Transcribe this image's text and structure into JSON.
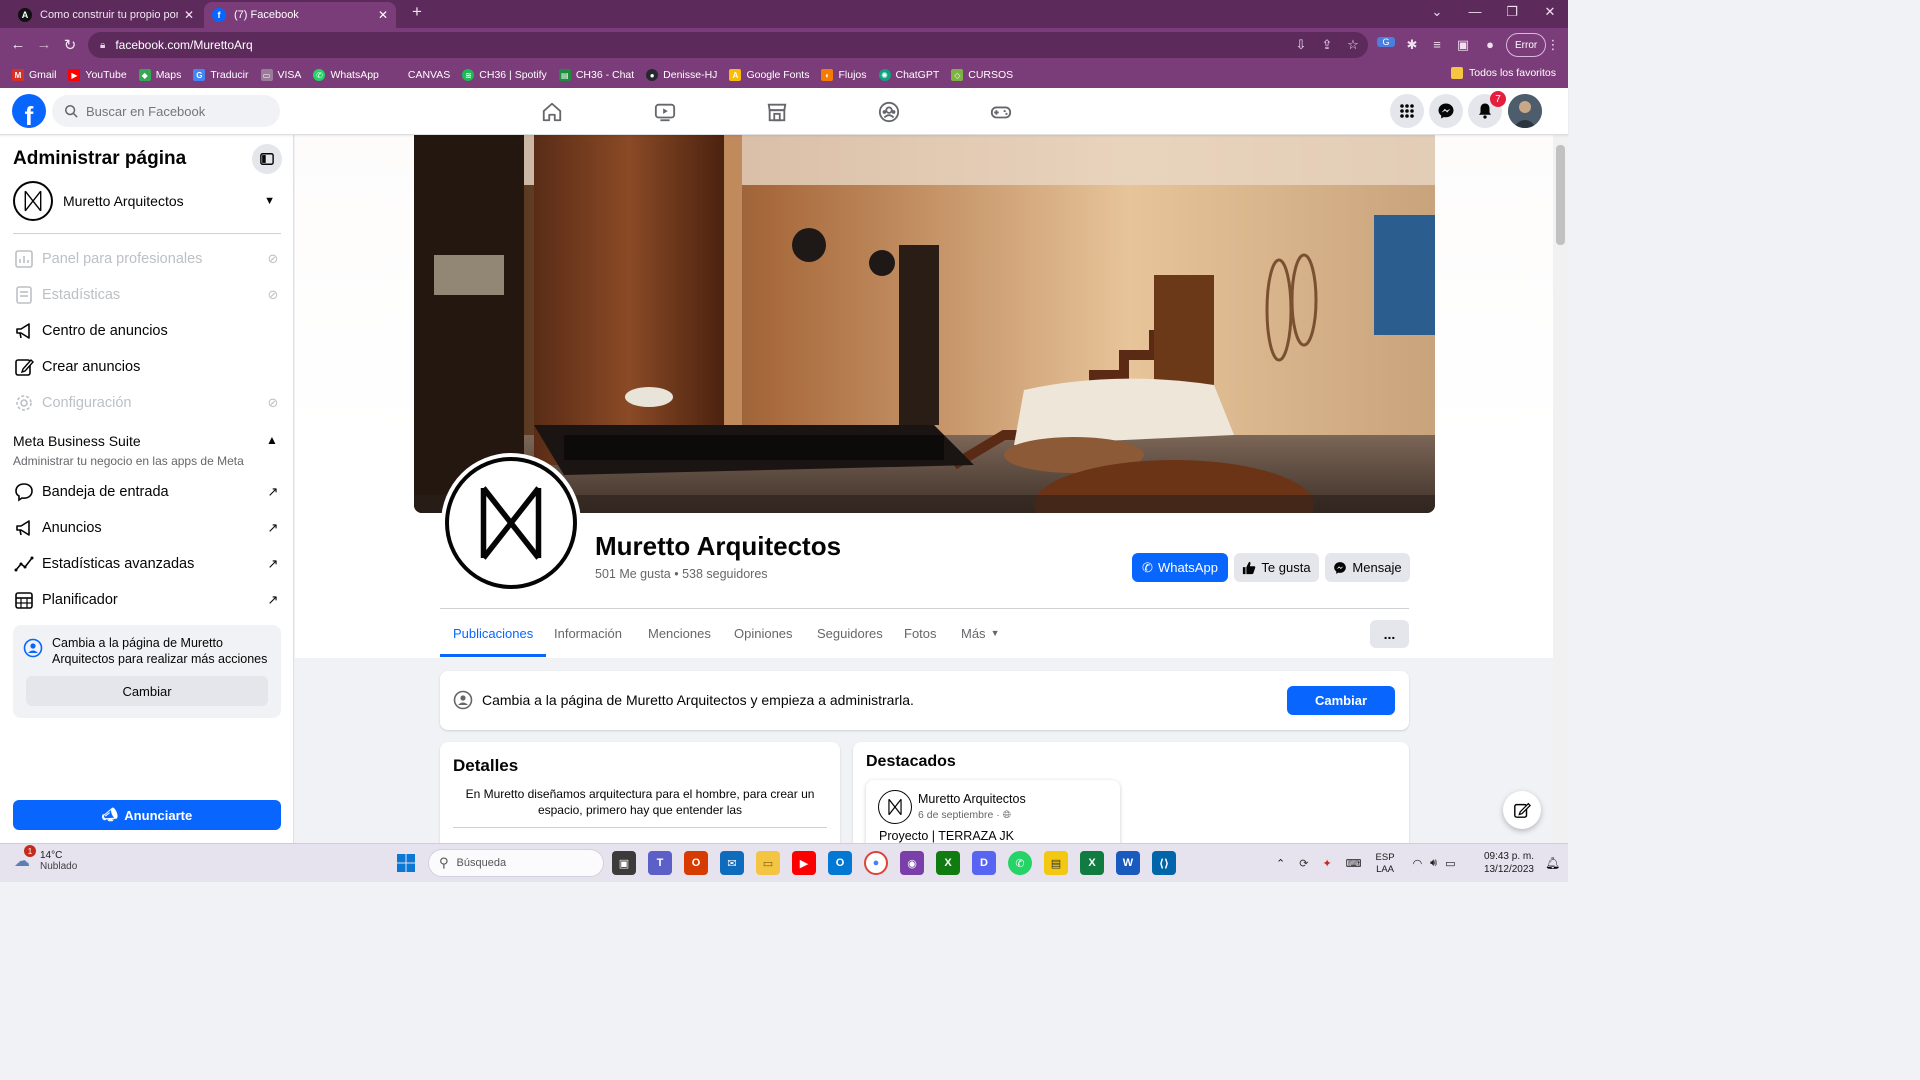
{
  "browser": {
    "tabs": [
      {
        "title": "Como construir tu propio portaf",
        "active": false
      },
      {
        "title": "(7) Facebook",
        "active": true
      }
    ],
    "url": "facebook.com/MurettoArq",
    "error_chip": "Error",
    "bookmarks": [
      "Gmail",
      "YouTube",
      "Maps",
      "Traducir",
      "VISA",
      "WhatsApp",
      "CANVAS",
      "CH36 | Spotify",
      "CH36 - Chat",
      "Denisse-HJ",
      "Google Fonts",
      "Flujos",
      "ChatGPT",
      "CURSOS"
    ],
    "bookmarks_all": "Todos los favoritos"
  },
  "header": {
    "search_placeholder": "Buscar en Facebook",
    "notification_count": "7",
    "nav_icons": [
      "home-icon",
      "video-icon",
      "marketplace-icon",
      "groups-icon",
      "gaming-icon"
    ]
  },
  "sidebar": {
    "title": "Administrar página",
    "page_name": "Muretto Arquitectos",
    "items_top": [
      {
        "label": "Panel para profesionales",
        "disabled": true
      },
      {
        "label": "Estadísticas",
        "disabled": true
      },
      {
        "label": "Centro de anuncios",
        "disabled": false
      },
      {
        "label": "Crear anuncios",
        "disabled": false
      },
      {
        "label": "Configuración",
        "disabled": true
      }
    ],
    "mbs_title": "Meta Business Suite",
    "mbs_subtitle": "Administrar tu negocio en las apps de Meta",
    "items_mbs": [
      {
        "label": "Bandeja de entrada"
      },
      {
        "label": "Anuncios"
      },
      {
        "label": "Estadísticas avanzadas"
      },
      {
        "label": "Planificador"
      }
    ],
    "switch_text": "Cambia a la página de Muretto Arquitectos para realizar más acciones",
    "switch_button": "Cambiar",
    "promote_button": "Anunciarte"
  },
  "profile": {
    "name": "Muretto Arquitectos",
    "stats": "501 Me gusta • 538 seguidores",
    "btn_whatsapp": "WhatsApp",
    "btn_like": "Te gusta",
    "btn_message": "Mensaje",
    "tabs": [
      "Publicaciones",
      "Información",
      "Menciones",
      "Opiniones",
      "Seguidores",
      "Fotos",
      "Más"
    ],
    "active_tab": "Publicaciones",
    "more_options": "..."
  },
  "switch_banner": {
    "text": "Cambia a la página de Muretto Arquitectos y empieza a administrarla.",
    "button": "Cambiar"
  },
  "details": {
    "title": "Detalles",
    "bio": "En Muretto diseñamos arquitectura para el hombre, para crear un espacio, primero hay que entender las"
  },
  "featured": {
    "title": "Destacados",
    "post_author": "Muretto Arquitectos",
    "post_date": "6 de septiembre ·",
    "post_text": "Proyecto | TERRAZA JK"
  },
  "taskbar": {
    "weather_temp": "14°C",
    "weather_desc": "Nublado",
    "weather_badge": "1",
    "search_placeholder": "Búsqueda",
    "lang_top": "ESP",
    "lang_bottom": "LAA",
    "time": "09:43 p. m.",
    "date": "13/12/2023"
  }
}
